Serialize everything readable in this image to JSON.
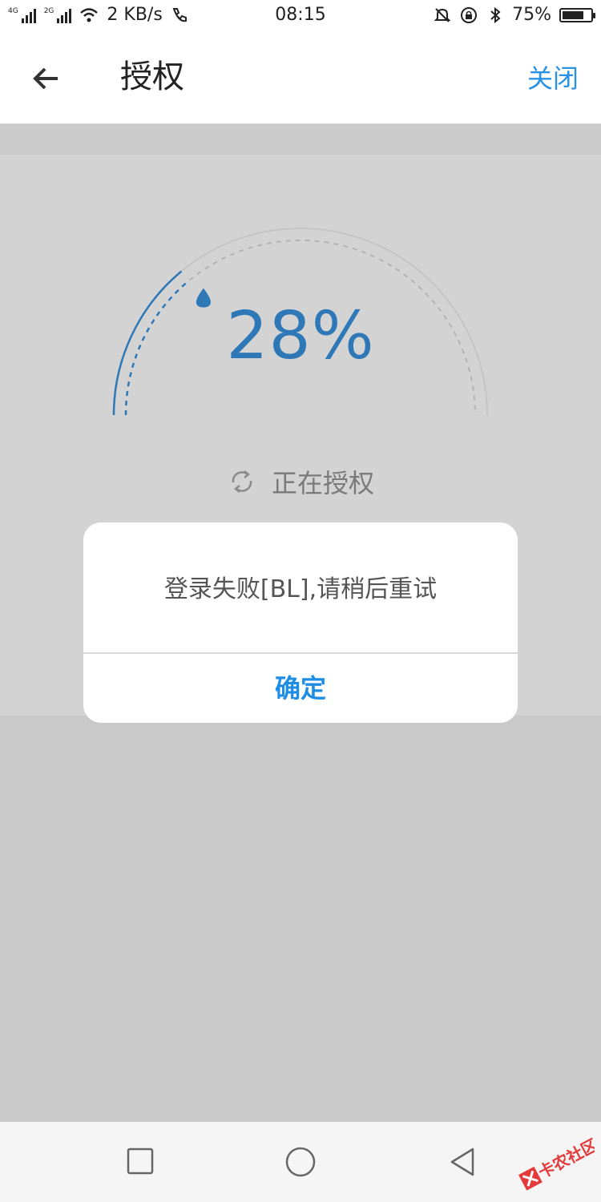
{
  "status_bar": {
    "network_1": "4G",
    "network_2": "2G",
    "speed": "2 KB/s",
    "time": "08:15",
    "battery": "75%",
    "battery_level": 0.75,
    "icons": [
      "signal-icon",
      "wifi-icon",
      "call-icon",
      "mute-icon",
      "lock-rotation-icon",
      "bluetooth-icon",
      "battery-icon"
    ]
  },
  "header": {
    "title": "授权",
    "close_label": "关闭"
  },
  "progress": {
    "percent_text": "28%",
    "value": 0.28,
    "status_text": "正在授权",
    "accent_color": "#2f78b7"
  },
  "dialog": {
    "message": "登录失败[BL],请稍后重试",
    "confirm_label": "确定",
    "confirm_color": "#1d8de6"
  },
  "watermark": {
    "text": "卡农社区"
  }
}
